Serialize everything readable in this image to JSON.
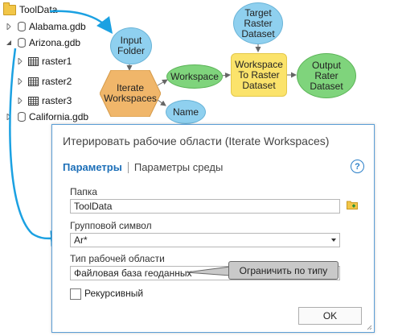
{
  "tree": {
    "root": "ToolData",
    "items": [
      {
        "label": "Alabama.gdb"
      },
      {
        "label": "Arizona.gdb"
      },
      {
        "label": "raster1"
      },
      {
        "label": "raster2"
      },
      {
        "label": "raster3"
      },
      {
        "label": "California.gdb"
      }
    ]
  },
  "model": {
    "input_folder": "Input\nFolder",
    "iterate_workspaces": "Iterate\nWorkspaces",
    "workspace": "Workspace",
    "name": "Name",
    "target_raster": "Target\nRaster\nDataset",
    "ws_to_raster": "Workspace\nTo Raster\nDataset",
    "output_rater": "Output\nRater\nDataset"
  },
  "dialog": {
    "title": "Итерировать рабочие области (Iterate Workspaces)",
    "tab_params": "Параметры",
    "tab_env": "Параметры среды",
    "help": "?",
    "folder_label": "Папка",
    "folder_value": "ToolData",
    "wildcard_label": "Групповой символ",
    "wildcard_value": "Ar*",
    "ws_type_label": "Тип рабочей области",
    "ws_type_value": "Файловая база геоданных",
    "recursive_label": "Рекурсивный",
    "ok_label": "OK"
  },
  "callout": "Ограничить по типу",
  "colors": {
    "arrow": "#1ba1e2",
    "blue_node": "#8fd0ef",
    "green_node": "#7fd47c",
    "orange_node": "#f0b66a",
    "yellow_node": "#fbe36b",
    "accent": "#1c6fb8"
  }
}
